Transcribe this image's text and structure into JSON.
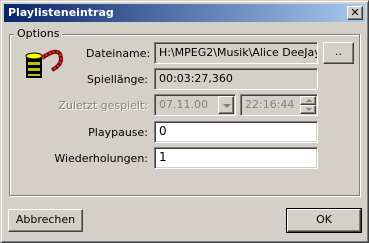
{
  "window": {
    "title": "Playlisteneintrag",
    "close_symbol": "✕"
  },
  "group": {
    "label": "Options"
  },
  "fields": {
    "dateiname": {
      "label": "Dateiname:",
      "value": "H:\\MPEG2\\Musik\\Alice DeeJay"
    },
    "browse_label": "..",
    "spiellaenge": {
      "label": "Spiellänge:",
      "value": "00:03:27,360"
    },
    "zuletzt": {
      "label": "Zuletzt gespielt:",
      "date": "07.11.00",
      "time": "22:16:44"
    },
    "playpause": {
      "label": "Playpause:",
      "value": "0"
    },
    "wiederholungen": {
      "label": "Wiederholungen:",
      "value": "1"
    }
  },
  "buttons": {
    "cancel": "Abbrechen",
    "ok": "OK"
  },
  "icons": {
    "film": "film-reel-icon",
    "dropdown": "chevron-down-icon"
  },
  "colors": {
    "titlebar_start": "#0a246a",
    "titlebar_end": "#a6caf0",
    "face": "#d4d0c8"
  }
}
